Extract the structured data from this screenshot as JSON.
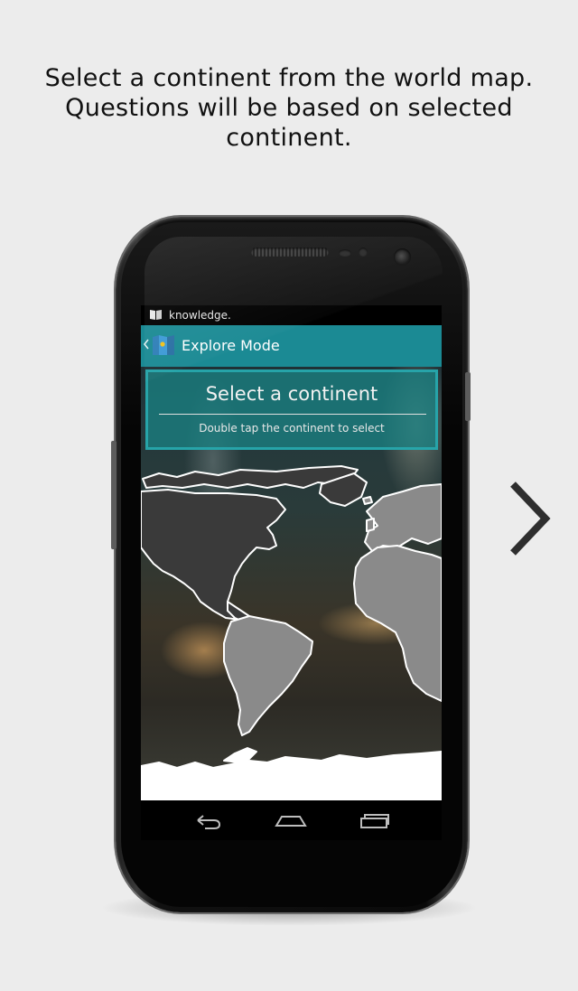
{
  "caption": {
    "line1": "Select a continent from the world map.",
    "line2": "Questions will be based on selected",
    "line3": "continent."
  },
  "status_bar": {
    "app_name": "knowledge.",
    "icon": "book-icon"
  },
  "action_bar": {
    "title": "Explore Mode",
    "back_icon": "chevron-left-icon",
    "logo_icon": "map-book-icon",
    "color": "#1b8a94"
  },
  "prompt": {
    "title": "Select a continent",
    "subtitle": "Double tap the continent to select"
  },
  "map": {
    "continents": [
      "North America",
      "South America",
      "Europe",
      "Africa",
      "Antarctica"
    ]
  },
  "nav_bar": {
    "buttons": [
      "back-icon",
      "home-icon",
      "recent-apps-icon"
    ]
  },
  "next_arrow": {
    "icon": "chevron-right-icon"
  },
  "colors": {
    "background": "#ececec",
    "dark_land": "#3a3a3a",
    "light_land": "#8a8a8a",
    "antarctica": "#ffffff",
    "prompt_box": "#1a8082"
  }
}
